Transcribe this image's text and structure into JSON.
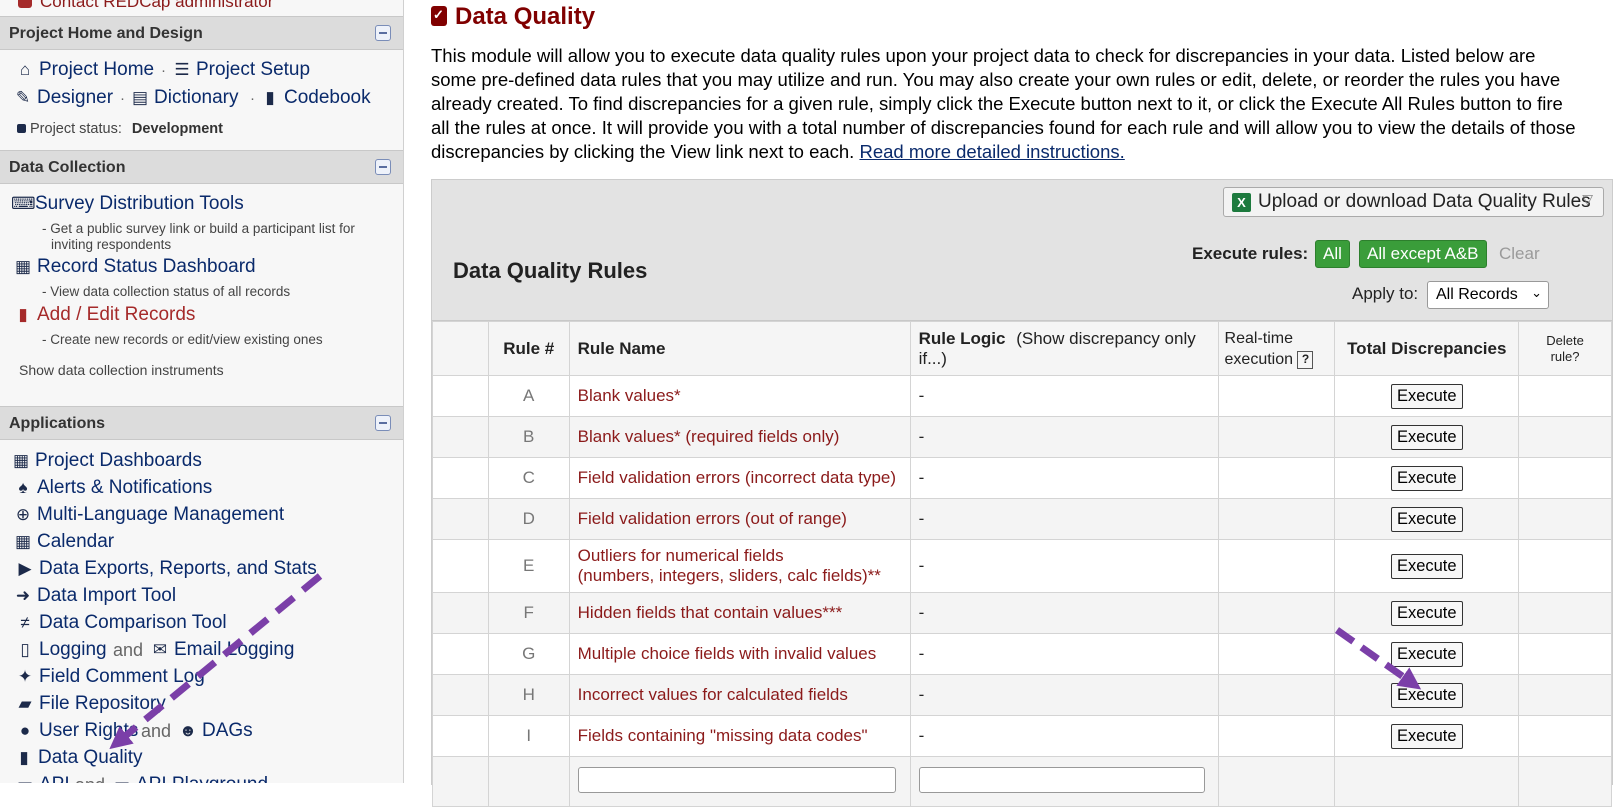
{
  "sidebar": {
    "top_link": "Contact REDCap administrator",
    "sections": {
      "project_home": {
        "title": "Project Home and Design",
        "links": {
          "project_home": "Project Home",
          "project_setup": "Project Setup",
          "designer": "Designer",
          "dictionary": "Dictionary",
          "codebook": "Codebook"
        },
        "status_label": "Project status:",
        "status_value": "Development"
      },
      "data_collection": {
        "title": "Data Collection",
        "items": [
          {
            "label": "Survey Distribution Tools",
            "desc1": "- Get a public survey link or build a participant list for",
            "desc2": "inviting respondents"
          },
          {
            "label": "Record Status Dashboard",
            "desc1": "- View data collection status of all records"
          },
          {
            "label": "Add / Edit Records",
            "desc1": "- Create new records or edit/view existing ones"
          }
        ],
        "show_instruments": "Show data collection instruments"
      },
      "applications": {
        "title": "Applications",
        "items": {
          "project_dashboards": "Project Dashboards",
          "alerts": "Alerts & Notifications",
          "mlm": "Multi-Language Management",
          "calendar": "Calendar",
          "exports": "Data Exports, Reports, and Stats",
          "import": "Data Import Tool",
          "comparison": "Data Comparison Tool",
          "logging": "Logging",
          "and1": "and",
          "email_logging": "Email Logging",
          "field_comment": "Field Comment Log",
          "file_repo": "File Repository",
          "user_rights": "User Rights",
          "and2": "and",
          "dags": "DAGs",
          "data_quality": "Data Quality",
          "api": "API",
          "and3": "and",
          "api_playground": "API Playground"
        }
      }
    }
  },
  "main": {
    "title": "Data Quality",
    "intro": "This module will allow you to execute data quality rules upon your project data to check for discrepancies in your data. Listed below are some pre-defined data rules that you may utilize and run. You may also create your own rules or edit, delete, or reorder the rules you have already created. To find discrepancies for a given rule, simply click the Execute button next to it, or click the Execute All Rules button to fire all the rules at once. It will provide you with a total number of discrepancies found for each rule and will allow you to view the details of those discrepancies by clicking the View link next to each.",
    "intro_link": "Read more detailed instructions.",
    "upload_button": "Upload or download Data Quality Rules",
    "panel_title": "Data Quality Rules",
    "execute_rules_label": "Execute rules:",
    "btn_all": "All",
    "btn_all_except": "All except A&B",
    "btn_clear": "Clear",
    "apply_to_label": "Apply to:",
    "apply_to_value": "All Records",
    "table": {
      "headers": {
        "rule_num": "Rule #",
        "rule_name": "Rule Name",
        "rule_logic": "Rule Logic",
        "rule_logic_sub": "(Show discrepancy only if...)",
        "realtime_1": "Real-time",
        "realtime_2": "execution",
        "realtime_help": "?",
        "total": "Total Discrepancies",
        "delete_1": "Delete",
        "delete_2": "rule?"
      },
      "rows": [
        {
          "letter": "A",
          "name": "Blank values*",
          "logic": "-",
          "action": "Execute"
        },
        {
          "letter": "B",
          "name": "Blank values* (required fields only)",
          "logic": "-",
          "action": "Execute"
        },
        {
          "letter": "C",
          "name": "Field validation errors (incorrect data type)",
          "logic": "-",
          "action": "Execute"
        },
        {
          "letter": "D",
          "name": "Field validation errors (out of range)",
          "logic": "-",
          "action": "Execute"
        },
        {
          "letter": "E",
          "name": "Outliers for numerical fields",
          "name2": "(numbers, integers, sliders, calc fields)**",
          "logic": "-",
          "action": "Execute"
        },
        {
          "letter": "F",
          "name": "Hidden fields that contain values***",
          "logic": "-",
          "action": "Execute"
        },
        {
          "letter": "G",
          "name": "Multiple choice fields with invalid values",
          "logic": "-",
          "action": "Execute"
        },
        {
          "letter": "H",
          "name": "Incorrect values for calculated fields",
          "logic": "-",
          "action": "Execute"
        },
        {
          "letter": "I",
          "name": "Fields containing \"missing data codes\"",
          "logic": "-",
          "action": "Execute"
        }
      ]
    }
  },
  "colors": {
    "maroon": "#800000",
    "nav_blue": "#0a2a6b",
    "green": "#3a9d3a",
    "arrow_purple": "#7b3fa8"
  }
}
